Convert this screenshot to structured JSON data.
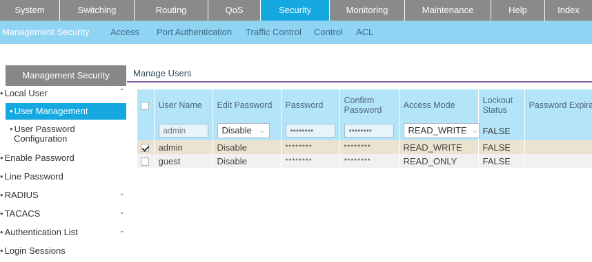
{
  "topnav": {
    "tabs": [
      {
        "label": "System"
      },
      {
        "label": "Switching"
      },
      {
        "label": "Routing"
      },
      {
        "label": "QoS"
      },
      {
        "label": "Security"
      },
      {
        "label": "Monitoring"
      },
      {
        "label": "Maintenance"
      },
      {
        "label": "Help"
      },
      {
        "label": "Index"
      }
    ],
    "active": "Security"
  },
  "subnav": {
    "items": [
      {
        "label": "Management Security"
      },
      {
        "label": "Access"
      },
      {
        "label": "Port Authentication"
      },
      {
        "label": "Traffic Control"
      },
      {
        "label": "Control"
      },
      {
        "label": "ACL"
      }
    ],
    "active": "Management Security"
  },
  "sidebar": {
    "title": "Management Security",
    "items": [
      {
        "label": "Local User"
      },
      {
        "label": "User Management"
      },
      {
        "label": "User Password"
      },
      {
        "label": "Configuration"
      },
      {
        "label": "Enable Password"
      },
      {
        "label": "Line Password"
      },
      {
        "label": "RADIUS"
      },
      {
        "label": "TACACS"
      },
      {
        "label": "Authentication List"
      },
      {
        "label": "Login Sessions"
      }
    ],
    "selected": "User Management"
  },
  "main": {
    "tab": "Manage Users",
    "table": {
      "headers": [
        "User Name",
        "Edit Password",
        "Password",
        "Confirm Password",
        "Access Mode",
        "Lockout Status",
        "Password Expiration Date"
      ],
      "edit_row": {
        "user_name_placeholder": "admin",
        "edit_password": "Disable",
        "password_placeholder": "••••••••",
        "confirm_placeholder": "••••••••",
        "access_mode": "READ_WRITE",
        "lockout": "FALSE"
      },
      "rows": [
        {
          "checked": true,
          "user_name": "admin",
          "edit_password": "Disable",
          "password": "********",
          "confirm": "********",
          "access_mode": "READ_WRITE",
          "lockout": "FALSE",
          "expiration": ""
        },
        {
          "checked": false,
          "user_name": "guest",
          "edit_password": "Disable",
          "password": "********",
          "confirm": "********",
          "access_mode": "READ_ONLY",
          "lockout": "FALSE",
          "expiration": ""
        }
      ]
    }
  },
  "colors": {
    "topnav_bg": "#8a8a8a",
    "active_tab": "#16a8e0",
    "subnav_bg": "#8fd4f2",
    "header_bg": "#b3e4f8",
    "selected_row": "#ebe3cf"
  }
}
